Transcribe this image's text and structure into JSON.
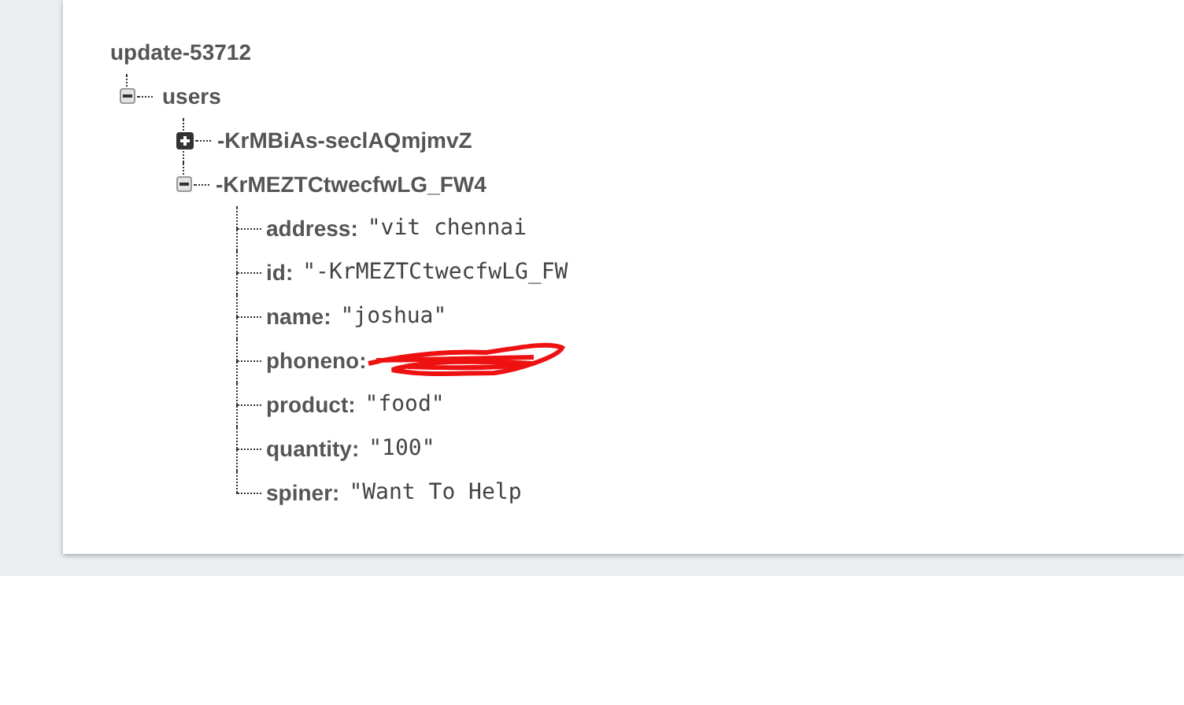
{
  "tree": {
    "label": "update-53712",
    "children": [
      {
        "label": "users",
        "expanded": true,
        "children": [
          {
            "label": "-KrMBiAs-seclAQmjmvZ",
            "expanded": false
          },
          {
            "label": "-KrMEZTCtwecfwLG_FW4",
            "expanded": true,
            "children": [
              {
                "key": "address:",
                "value": "\"vit chennai"
              },
              {
                "key": "id:",
                "value": "\"-KrMEZTCtwecfwLG_FW"
              },
              {
                "key": "name:",
                "value": "\"joshua\""
              },
              {
                "key": "phoneno:",
                "redacted": true
              },
              {
                "key": "product:",
                "value": "\"food\""
              },
              {
                "key": "quantity:",
                "value": "\"100\""
              },
              {
                "key": "spiner:",
                "value": "\"Want To Help"
              }
            ]
          }
        ]
      }
    ]
  }
}
